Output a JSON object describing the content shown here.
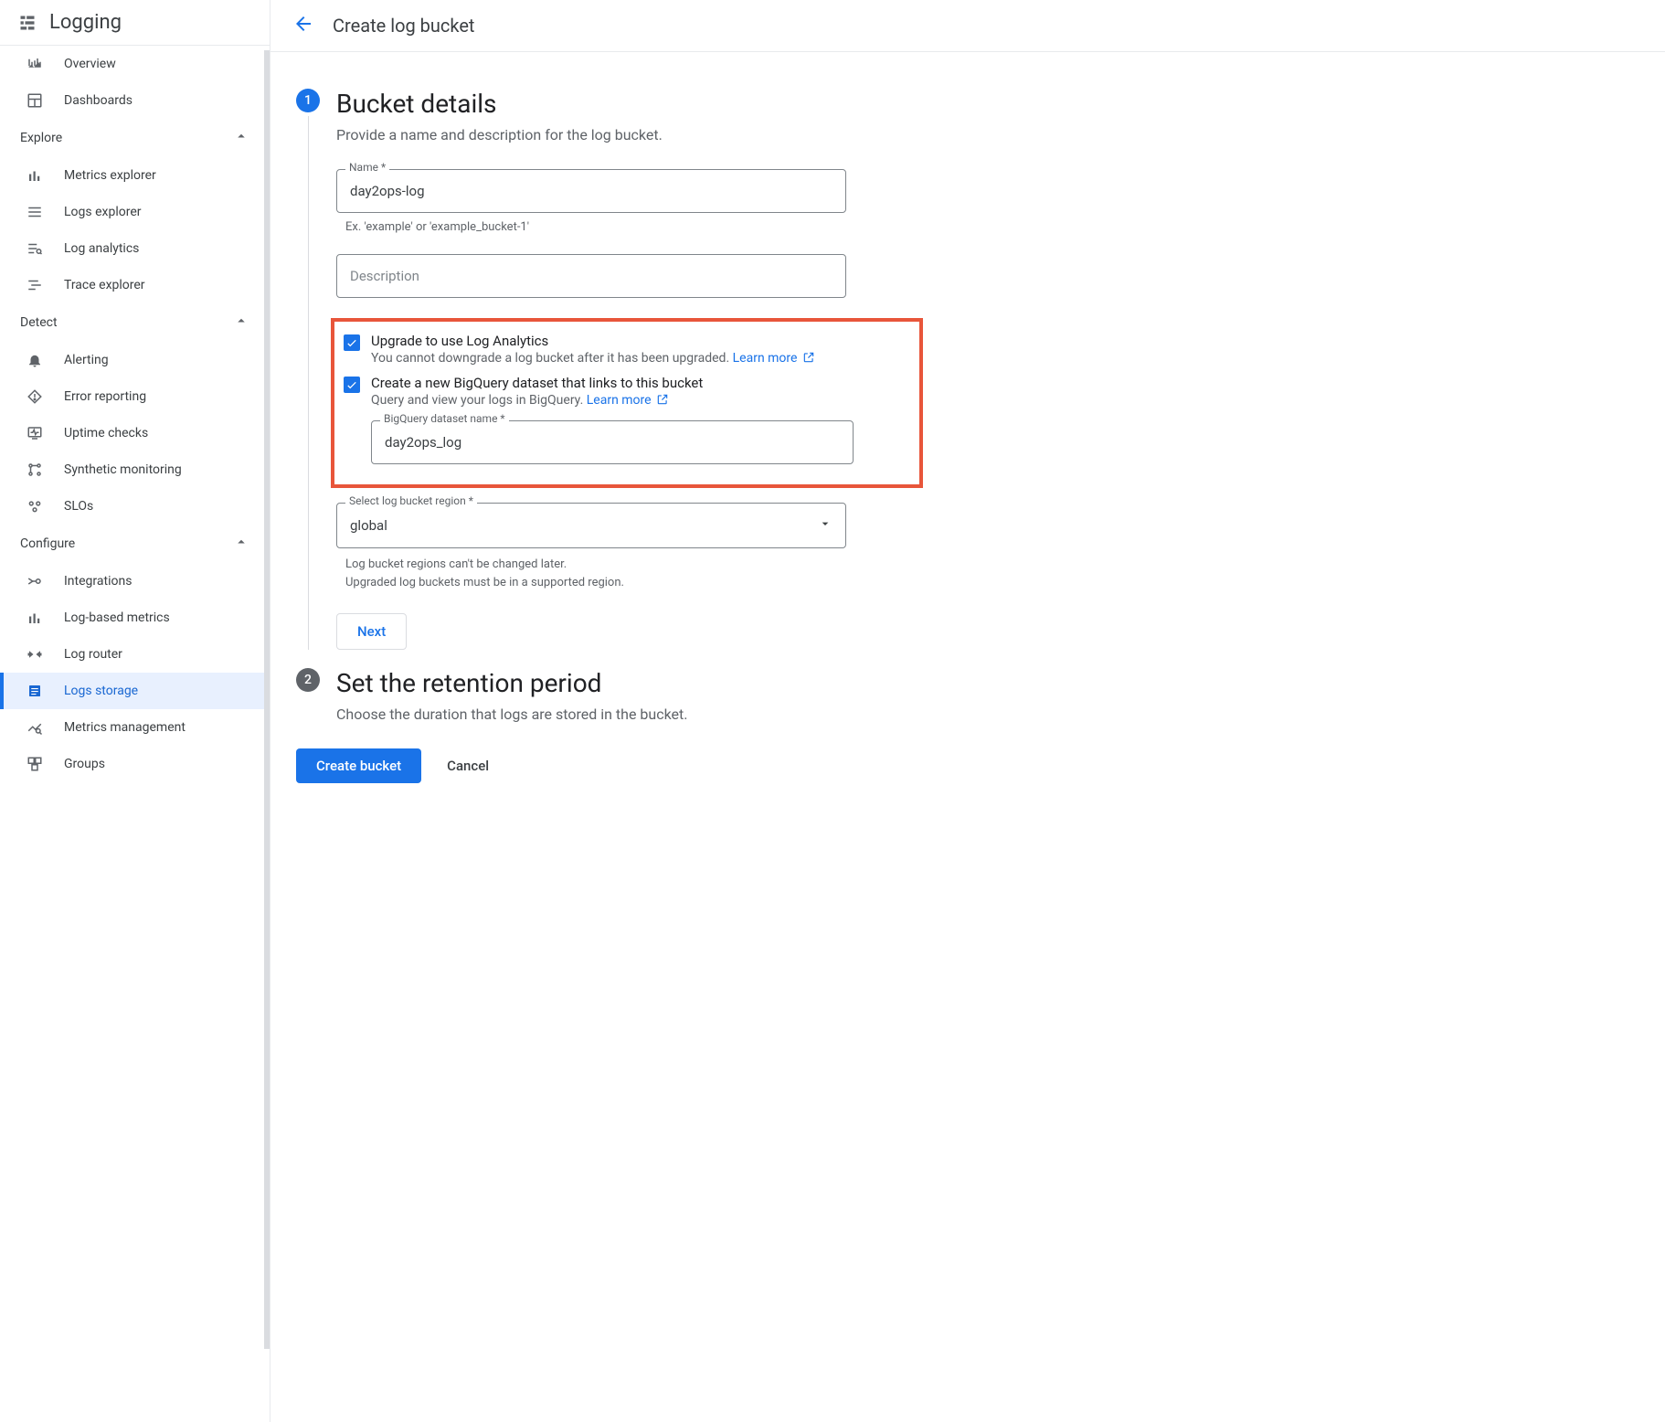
{
  "sidebar": {
    "title": "Logging",
    "top_items": [
      {
        "label": "Overview"
      },
      {
        "label": "Dashboards"
      }
    ],
    "sections": [
      {
        "header": "Explore",
        "items": [
          {
            "label": "Metrics explorer"
          },
          {
            "label": "Logs explorer"
          },
          {
            "label": "Log analytics"
          },
          {
            "label": "Trace explorer"
          }
        ]
      },
      {
        "header": "Detect",
        "items": [
          {
            "label": "Alerting"
          },
          {
            "label": "Error reporting"
          },
          {
            "label": "Uptime checks"
          },
          {
            "label": "Synthetic monitoring"
          },
          {
            "label": "SLOs"
          }
        ]
      },
      {
        "header": "Configure",
        "items": [
          {
            "label": "Integrations"
          },
          {
            "label": "Log-based metrics"
          },
          {
            "label": "Log router"
          },
          {
            "label": "Logs storage",
            "active": true
          },
          {
            "label": "Metrics management"
          },
          {
            "label": "Groups"
          }
        ]
      }
    ]
  },
  "header": {
    "title": "Create log bucket"
  },
  "step1": {
    "badge": "1",
    "title": "Bucket details",
    "subtitle": "Provide a name and description for the log bucket.",
    "name_label": "Name *",
    "name_value": "day2ops-log",
    "name_helper": "Ex. 'example' or 'example_bucket-1'",
    "description_placeholder": "Description",
    "upgrade_label": "Upgrade to use Log Analytics",
    "upgrade_helper": "You cannot downgrade a log bucket after it has been upgraded.",
    "learn_more": "Learn more",
    "bq_label": "Create a new BigQuery dataset that links to this bucket",
    "bq_helper": "Query and view your logs in BigQuery.",
    "bq_dataset_label": "BigQuery dataset name *",
    "bq_dataset_value": "day2ops_log",
    "region_label": "Select log bucket region *",
    "region_value": "global",
    "region_helper1": "Log bucket regions can't be changed later.",
    "region_helper2": "Upgraded log buckets must be in a supported region.",
    "next_label": "Next"
  },
  "step2": {
    "badge": "2",
    "title": "Set the retention period",
    "subtitle": "Choose the duration that logs are stored in the bucket."
  },
  "footer": {
    "create_label": "Create bucket",
    "cancel_label": "Cancel"
  }
}
